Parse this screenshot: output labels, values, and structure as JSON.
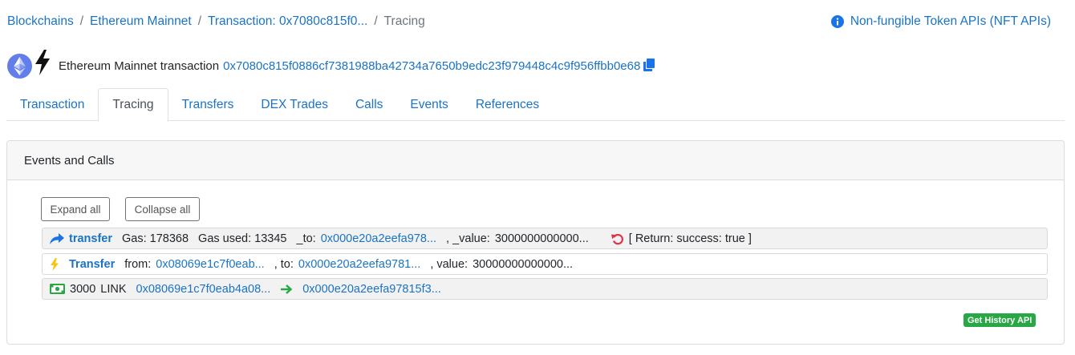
{
  "breadcrumb": {
    "items": [
      "Blockchains",
      "Ethereum Mainnet",
      "Transaction: 0x7080c815f0..."
    ],
    "current": "Tracing",
    "separator": "/"
  },
  "nft_link": {
    "label": "Non-fungible Token APIs (NFT APIs)",
    "icon": "info-circle-icon"
  },
  "title": {
    "text": "Ethereum Mainnet transaction",
    "hash": "0x7080c815f0886cf7381988ba42734a7650b9edc23f979448c4c9f956ffbb0e68",
    "icons": [
      "ethereum-icon",
      "lightning-bolt-icon",
      "copy-icon"
    ]
  },
  "tabs": [
    {
      "label": "Transaction",
      "active": false
    },
    {
      "label": "Tracing",
      "active": true
    },
    {
      "label": "Transfers",
      "active": false
    },
    {
      "label": "DEX Trades",
      "active": false
    },
    {
      "label": "Calls",
      "active": false
    },
    {
      "label": "Events",
      "active": false
    },
    {
      "label": "References",
      "active": false
    }
  ],
  "card": {
    "header": "Events and Calls",
    "expand_all": "Expand all",
    "collapse_all": "Collapse all",
    "rows": {
      "call": {
        "icon": "share-arrow-icon",
        "name": "transfer",
        "gas_label": "Gas: 178368",
        "gas_used_label": "Gas used: 13345",
        "to_label": "_to:",
        "to_value": "0x000e20a2eefa978...",
        "value_label": ",  _value:",
        "value_value": "3000000000000...",
        "return_icon": "undo-icon",
        "return_text": "[ Return:  success:  true  ]"
      },
      "event": {
        "icon": "lightning-icon",
        "name": "Transfer",
        "from_label": "from:",
        "from_value": "0x08069e1c7f0eab...",
        "to_label": ",  to:",
        "to_value": "0x000e20a2eefa9781...",
        "value_label": ",  value:",
        "value_value": "30000000000000..."
      },
      "transfer": {
        "icon": "money-bill-icon",
        "amount": "3000",
        "currency": "LINK",
        "from": "0x08069e1c7f0eab4a08...",
        "arrow_icon": "arrow-right-icon",
        "to": "0x000e20a2eefa97815f3..."
      }
    },
    "api_badge": "Get History API"
  },
  "colors": {
    "link": "#1a73c4",
    "badge_green": "#28a745",
    "return_red": "#dc3545",
    "arrow_green": "#28a745",
    "bolt_yellow": "#f5c518"
  }
}
